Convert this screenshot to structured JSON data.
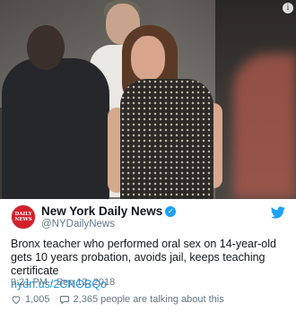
{
  "tweet": {
    "author_name": "New York Daily News",
    "author_handle": "@NYDailyNews",
    "avatar_text_line1": "DAILY",
    "avatar_text_line2": "NEWS",
    "verified": true,
    "text": "Bronx teacher who performed oral sex on 14-year-old gets 10 years probation, avoids jail, keeps teaching certificate",
    "link": "nydn.us/2CNOBQo",
    "timestamp": "9:21 PM - Sep 12, 2018",
    "likes": "1,005",
    "conversation": "2,365 people are talking about this",
    "info_badge": "i"
  },
  "icons": {
    "verified": "verified-badge-icon",
    "brand": "twitter-bird-icon",
    "like": "heart-icon",
    "reply": "speech-bubble-icon",
    "info": "info-icon"
  },
  "colors": {
    "link": "#1b95e0",
    "twitter_blue": "#1da1f2",
    "muted_text": "#657786",
    "avatar_red": "#d3202a"
  }
}
